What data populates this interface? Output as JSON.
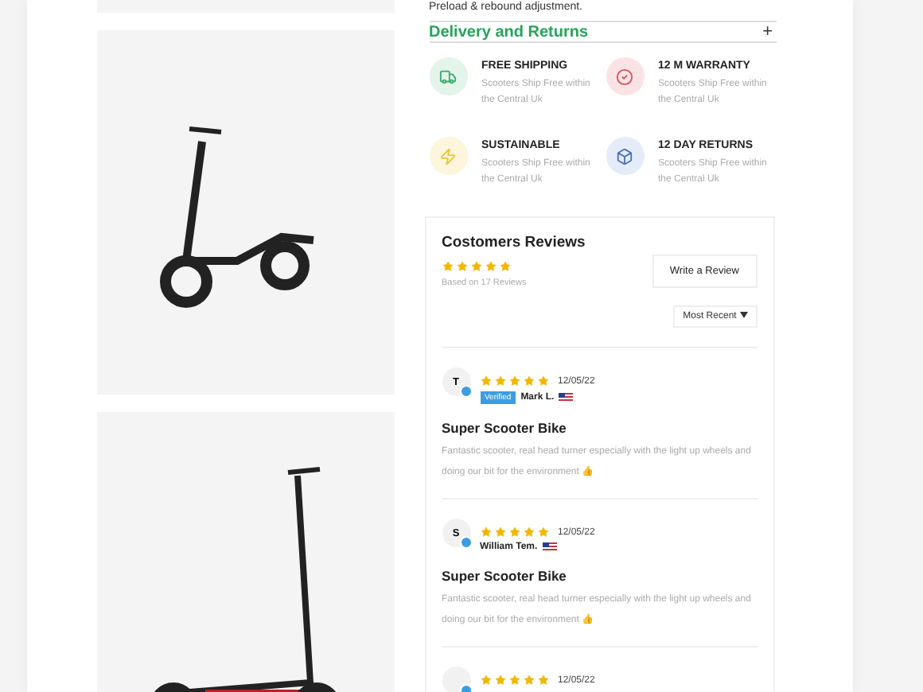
{
  "intro_text": "Preload & rebound adjustment.",
  "accordion": {
    "title": "Delivery and Returns",
    "toggle": "+",
    "expanded": false
  },
  "features": [
    {
      "kind": "truck",
      "title": "FREE SHIPPING",
      "text": "Scooters Ship Free within the Central Uk",
      "color": "#e3f4ea"
    },
    {
      "kind": "check",
      "title": "12 M WARRANTY",
      "text": "Scooters Ship Free within the Central Uk",
      "color": "#fbe3e5"
    },
    {
      "kind": "zap",
      "title": "SUSTAINABLE",
      "text": "Scooters Ship Free within the Central Uk",
      "color": "#fdf5dc"
    },
    {
      "kind": "box",
      "title": "12 DAY RETURNS",
      "text": "Scooters Ship Free within the Central Uk",
      "color": "#e4ecfa"
    }
  ],
  "reviews": {
    "title": "Costomers Reviews",
    "stars": 5,
    "based_on": "Based on 17 Reviews",
    "write_button": "Write a Review",
    "sort": "Most Recent",
    "items": [
      {
        "initial": "T",
        "stars": 5,
        "date": "12/05/22",
        "badge": "Verified",
        "name": "Mark L.",
        "title": "Super Scooter Bike",
        "body": "Fantastic scooter, real head turner especially with the light up wheels and doing our bit for the environment 👍"
      },
      {
        "initial": "S",
        "stars": 5,
        "date": "12/05/22",
        "name": "William Tem.",
        "title": "Super Scooter Bike",
        "body": "Fantastic scooter, real head turner especially with the light up wheels and doing our bit for the environment 👍"
      },
      {
        "stars": 5,
        "date": "12/05/22"
      }
    ]
  }
}
